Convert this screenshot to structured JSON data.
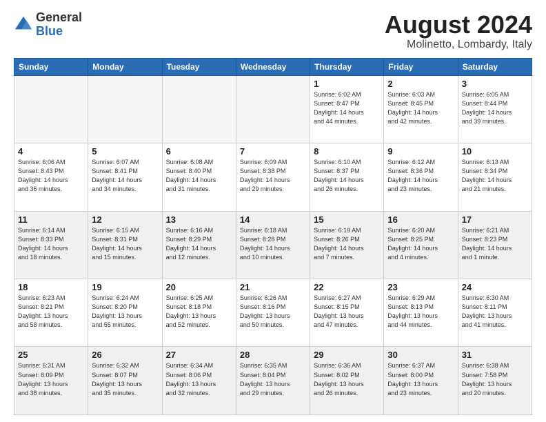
{
  "header": {
    "logo_general": "General",
    "logo_blue": "Blue",
    "title": "August 2024",
    "subtitle": "Molinetto, Lombardy, Italy"
  },
  "days_of_week": [
    "Sunday",
    "Monday",
    "Tuesday",
    "Wednesday",
    "Thursday",
    "Friday",
    "Saturday"
  ],
  "weeks": [
    [
      {
        "day": "",
        "empty": true
      },
      {
        "day": "",
        "empty": true
      },
      {
        "day": "",
        "empty": true
      },
      {
        "day": "",
        "empty": true
      },
      {
        "day": "1",
        "info": "Sunrise: 6:02 AM\nSunset: 8:47 PM\nDaylight: 14 hours\nand 44 minutes."
      },
      {
        "day": "2",
        "info": "Sunrise: 6:03 AM\nSunset: 8:45 PM\nDaylight: 14 hours\nand 42 minutes."
      },
      {
        "day": "3",
        "info": "Sunrise: 6:05 AM\nSunset: 8:44 PM\nDaylight: 14 hours\nand 39 minutes."
      }
    ],
    [
      {
        "day": "4",
        "info": "Sunrise: 6:06 AM\nSunset: 8:43 PM\nDaylight: 14 hours\nand 36 minutes."
      },
      {
        "day": "5",
        "info": "Sunrise: 6:07 AM\nSunset: 8:41 PM\nDaylight: 14 hours\nand 34 minutes."
      },
      {
        "day": "6",
        "info": "Sunrise: 6:08 AM\nSunset: 8:40 PM\nDaylight: 14 hours\nand 31 minutes."
      },
      {
        "day": "7",
        "info": "Sunrise: 6:09 AM\nSunset: 8:38 PM\nDaylight: 14 hours\nand 29 minutes."
      },
      {
        "day": "8",
        "info": "Sunrise: 6:10 AM\nSunset: 8:37 PM\nDaylight: 14 hours\nand 26 minutes."
      },
      {
        "day": "9",
        "info": "Sunrise: 6:12 AM\nSunset: 8:36 PM\nDaylight: 14 hours\nand 23 minutes."
      },
      {
        "day": "10",
        "info": "Sunrise: 6:13 AM\nSunset: 8:34 PM\nDaylight: 14 hours\nand 21 minutes."
      }
    ],
    [
      {
        "day": "11",
        "info": "Sunrise: 6:14 AM\nSunset: 8:33 PM\nDaylight: 14 hours\nand 18 minutes."
      },
      {
        "day": "12",
        "info": "Sunrise: 6:15 AM\nSunset: 8:31 PM\nDaylight: 14 hours\nand 15 minutes."
      },
      {
        "day": "13",
        "info": "Sunrise: 6:16 AM\nSunset: 8:29 PM\nDaylight: 14 hours\nand 12 minutes."
      },
      {
        "day": "14",
        "info": "Sunrise: 6:18 AM\nSunset: 8:28 PM\nDaylight: 14 hours\nand 10 minutes."
      },
      {
        "day": "15",
        "info": "Sunrise: 6:19 AM\nSunset: 8:26 PM\nDaylight: 14 hours\nand 7 minutes."
      },
      {
        "day": "16",
        "info": "Sunrise: 6:20 AM\nSunset: 8:25 PM\nDaylight: 14 hours\nand 4 minutes."
      },
      {
        "day": "17",
        "info": "Sunrise: 6:21 AM\nSunset: 8:23 PM\nDaylight: 14 hours\nand 1 minute."
      }
    ],
    [
      {
        "day": "18",
        "info": "Sunrise: 6:23 AM\nSunset: 8:21 PM\nDaylight: 13 hours\nand 58 minutes."
      },
      {
        "day": "19",
        "info": "Sunrise: 6:24 AM\nSunset: 8:20 PM\nDaylight: 13 hours\nand 55 minutes."
      },
      {
        "day": "20",
        "info": "Sunrise: 6:25 AM\nSunset: 8:18 PM\nDaylight: 13 hours\nand 52 minutes."
      },
      {
        "day": "21",
        "info": "Sunrise: 6:26 AM\nSunset: 8:16 PM\nDaylight: 13 hours\nand 50 minutes."
      },
      {
        "day": "22",
        "info": "Sunrise: 6:27 AM\nSunset: 8:15 PM\nDaylight: 13 hours\nand 47 minutes."
      },
      {
        "day": "23",
        "info": "Sunrise: 6:29 AM\nSunset: 8:13 PM\nDaylight: 13 hours\nand 44 minutes."
      },
      {
        "day": "24",
        "info": "Sunrise: 6:30 AM\nSunset: 8:11 PM\nDaylight: 13 hours\nand 41 minutes."
      }
    ],
    [
      {
        "day": "25",
        "info": "Sunrise: 6:31 AM\nSunset: 8:09 PM\nDaylight: 13 hours\nand 38 minutes."
      },
      {
        "day": "26",
        "info": "Sunrise: 6:32 AM\nSunset: 8:07 PM\nDaylight: 13 hours\nand 35 minutes."
      },
      {
        "day": "27",
        "info": "Sunrise: 6:34 AM\nSunset: 8:06 PM\nDaylight: 13 hours\nand 32 minutes."
      },
      {
        "day": "28",
        "info": "Sunrise: 6:35 AM\nSunset: 8:04 PM\nDaylight: 13 hours\nand 29 minutes."
      },
      {
        "day": "29",
        "info": "Sunrise: 6:36 AM\nSunset: 8:02 PM\nDaylight: 13 hours\nand 26 minutes."
      },
      {
        "day": "30",
        "info": "Sunrise: 6:37 AM\nSunset: 8:00 PM\nDaylight: 13 hours\nand 23 minutes."
      },
      {
        "day": "31",
        "info": "Sunrise: 6:38 AM\nSunset: 7:58 PM\nDaylight: 13 hours\nand 20 minutes."
      }
    ]
  ]
}
